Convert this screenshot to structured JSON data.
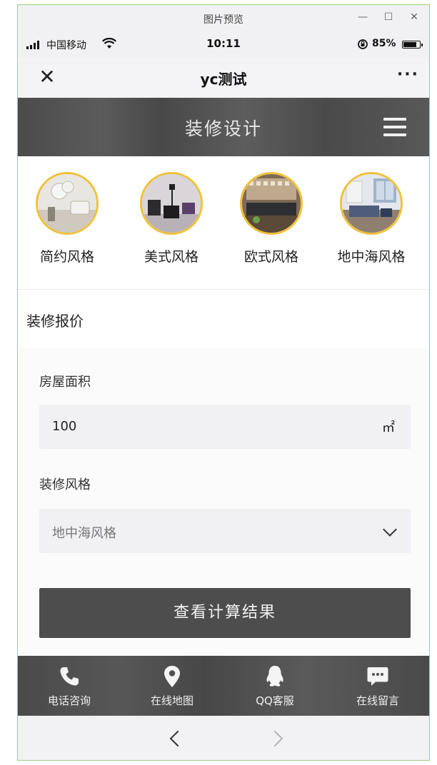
{
  "window": {
    "title": "图片预览",
    "minimize": "—",
    "maximize": "☐",
    "close": "✕"
  },
  "status": {
    "carrier": "中国移动",
    "time": "10:11",
    "battery": "85%"
  },
  "nav": {
    "close": "✕",
    "title": "yc测试",
    "more": "···"
  },
  "header": {
    "title": "装修设计"
  },
  "styles": [
    {
      "label": "简约风格"
    },
    {
      "label": "美式风格"
    },
    {
      "label": "欧式风格"
    },
    {
      "label": "地中海风格"
    }
  ],
  "tab": {
    "active": "装修报价"
  },
  "form": {
    "area_label": "房屋面积",
    "area_value": "100",
    "area_unit": "㎡",
    "style_label": "装修风格",
    "style_value": "地中海风格",
    "submit": "查看计算结果"
  },
  "bottom": [
    {
      "label": "电话咨询",
      "icon": "phone-icon"
    },
    {
      "label": "在线地图",
      "icon": "map-pin-icon"
    },
    {
      "label": "QQ客服",
      "icon": "qq-icon"
    },
    {
      "label": "在线留言",
      "icon": "message-icon"
    }
  ],
  "colors": {
    "header_bg": "#4f4f4f",
    "accent_ring": "#f0c13a",
    "button_bg": "#4d4d4d"
  }
}
